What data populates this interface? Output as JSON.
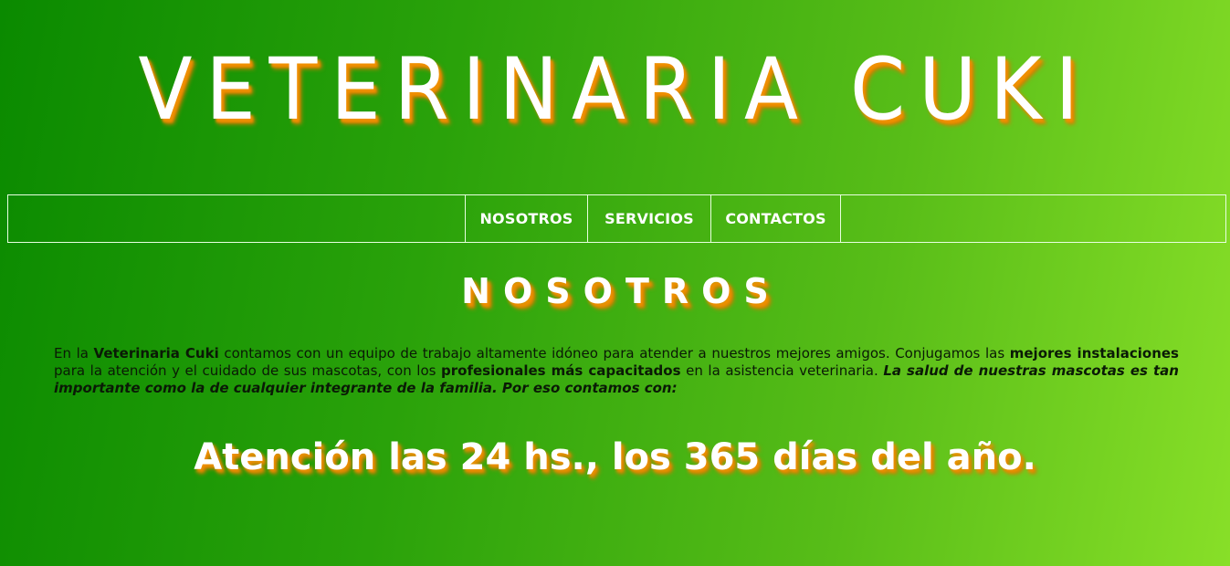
{
  "header": {
    "title": "VETERINARIA CUKI"
  },
  "nav": {
    "items": [
      {
        "label": "NOSOTROS"
      },
      {
        "label": "SERVICIOS"
      },
      {
        "label": "CONTACTOS"
      }
    ]
  },
  "main": {
    "section_title": "NOSOTROS",
    "intro": {
      "p1": "En la ",
      "b1": "Veterinaria Cuki",
      "p2": " contamos con un equipo de trabajo altamente idóneo para atender a nuestros mejores amigos. Conjugamos las ",
      "b2": "mejores instalaciones",
      "p3": " para la atención y el cuidado de sus mascotas, con los ",
      "b3": "profesionales más capacitados",
      "p4": " en la asistencia veterinaria. ",
      "em1": "La salud de nuestras mascotas es tan importante como la de cualquier integrante de la familia. Por eso contamos con:"
    },
    "highlight": "Atención las 24 hs., los 365 días del año."
  },
  "colors": {
    "gradient_start": "#0a8a00",
    "gradient_end": "#88df28",
    "text_shadow": "#f09000",
    "heading_text": "#ffffff"
  }
}
